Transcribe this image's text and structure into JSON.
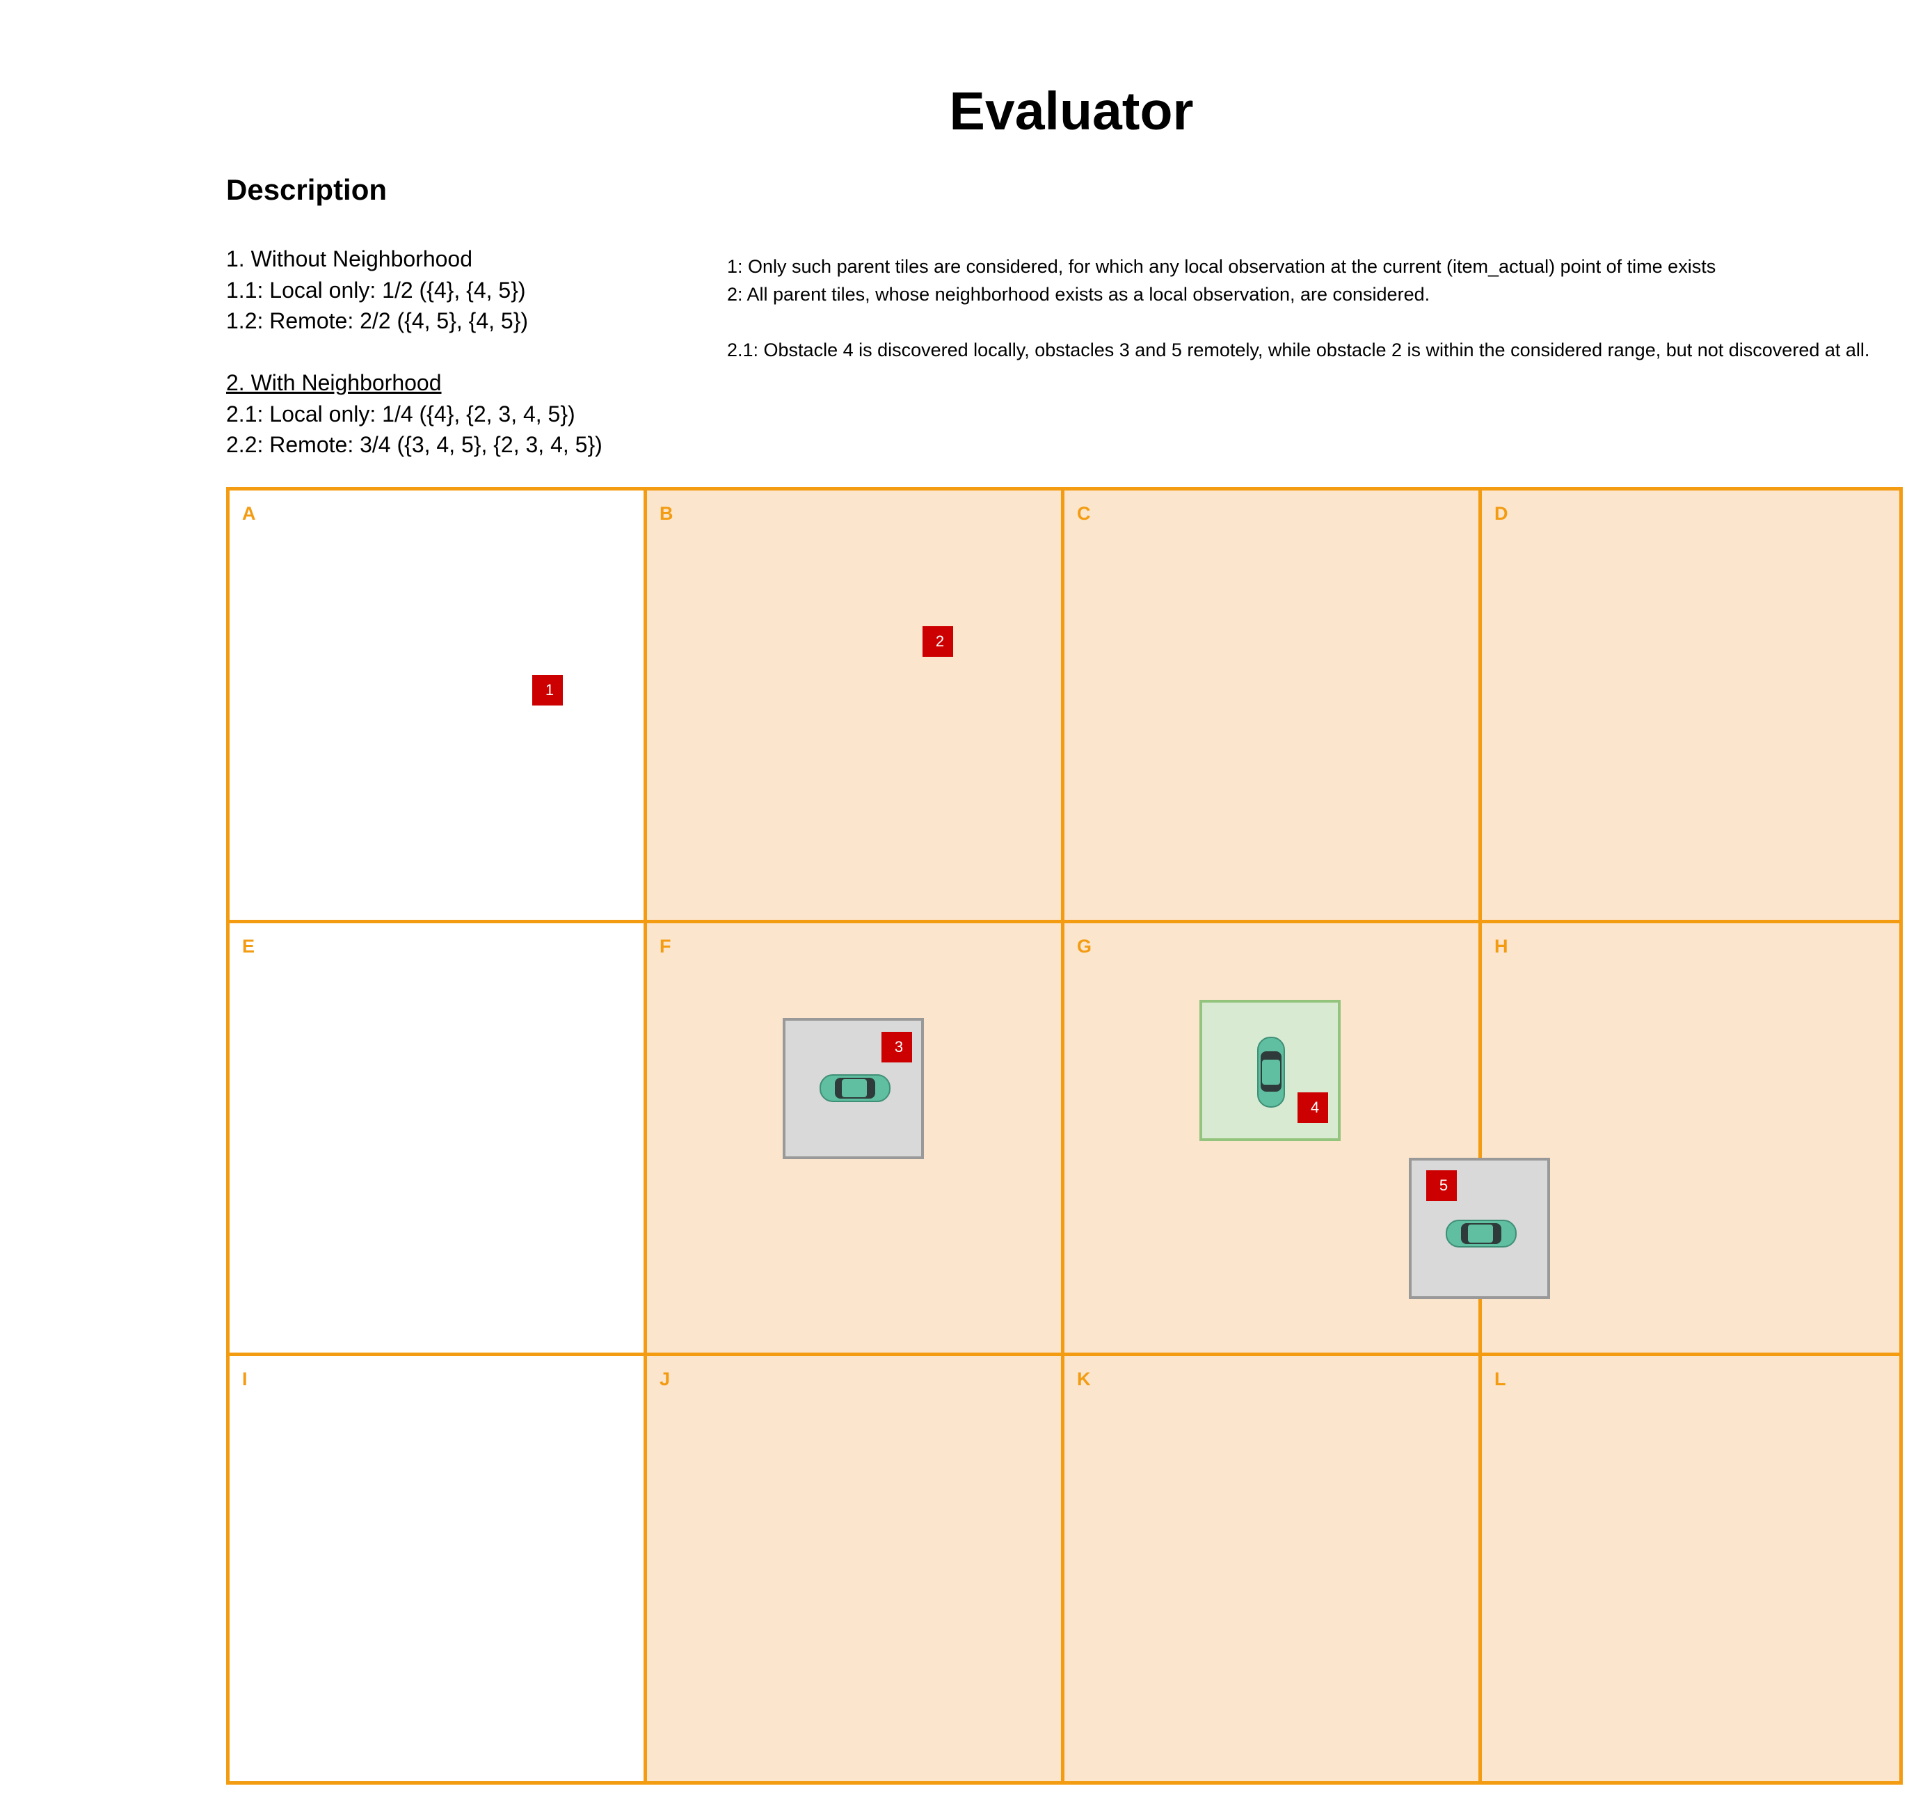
{
  "title": "Evaluator",
  "description_heading": "Description",
  "without_neighborhood": {
    "heading": "1. Without Neighborhood",
    "local": "1.1: Local only:  1/2  ({4}, {4, 5})",
    "remote": "1.2: Remote: 2/2 ({4, 5}, {4, 5})"
  },
  "with_neighborhood": {
    "heading": "2. With Neighborhood",
    "local": "2.1: Local only: 1/4 ({4}, {2, 3, 4, 5})",
    "remote": "2.2: Remote: 3/4 ({3, 4, 5}, {2, 3, 4, 5})"
  },
  "notes": {
    "note1": "1: Only such parent tiles are considered, for which any local observation at the current (item_actual) point of time exists",
    "note2": "2: All parent tiles, whose neighborhood exists as a local observation, are considered.",
    "note3": "2.1: Obstacle 4 is discovered locally, obstacles 3 and 5 remotely, while obstacle 2 is within the considered range, but not discovered at all."
  },
  "colors": {
    "tile_border": "#f39c12",
    "tile_shaded": "#fbe5cd",
    "obstacle": "#cc0000",
    "remote_observation": "#d9d9d9",
    "local_observation": "#d9ead3",
    "car": "#5fbfa0"
  },
  "tiles": [
    {
      "label": "A",
      "shaded": false
    },
    {
      "label": "B",
      "shaded": true
    },
    {
      "label": "C",
      "shaded": true
    },
    {
      "label": "D",
      "shaded": true
    },
    {
      "label": "E",
      "shaded": false
    },
    {
      "label": "F",
      "shaded": true
    },
    {
      "label": "G",
      "shaded": true
    },
    {
      "label": "H",
      "shaded": true
    },
    {
      "label": "I",
      "shaded": false
    },
    {
      "label": "J",
      "shaded": true
    },
    {
      "label": "K",
      "shaded": true
    },
    {
      "label": "L",
      "shaded": true
    }
  ],
  "obstacles": [
    "1",
    "2",
    "3",
    "4",
    "5"
  ]
}
